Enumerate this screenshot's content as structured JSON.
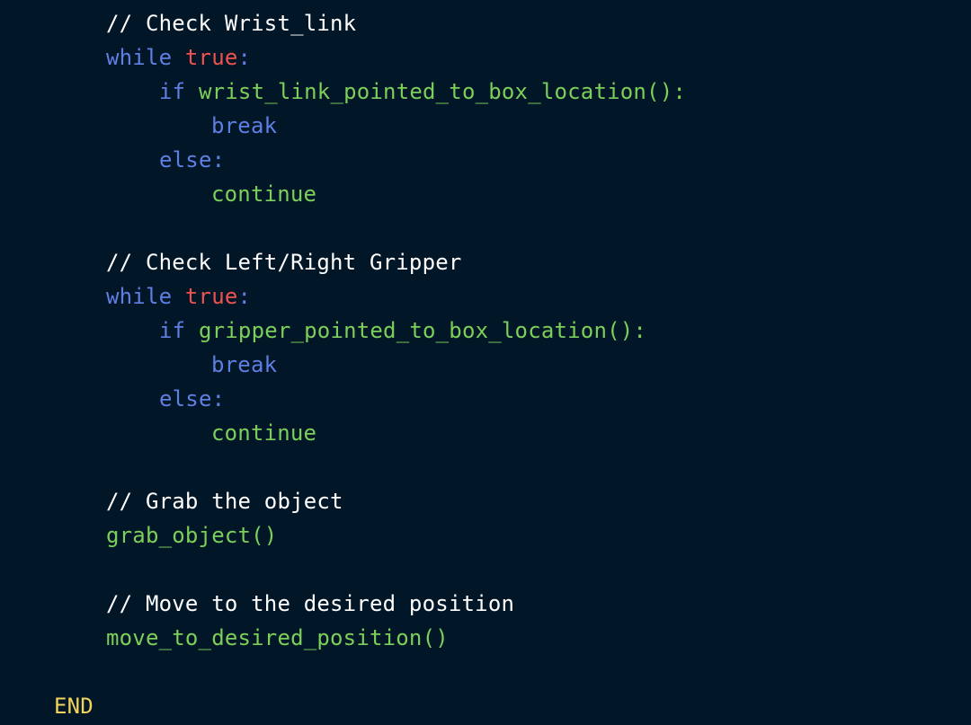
{
  "code": {
    "block1": {
      "comment": "// Check Wrist_link",
      "while_kw": "while",
      "true_kw": "true",
      "colon": ":",
      "if_kw": "if",
      "condition": "wrist_link_pointed_to_box_location():",
      "break_kw": "break",
      "else_kw": "else:",
      "continue_kw": "continue"
    },
    "block2": {
      "comment": "// Check Left/Right Gripper",
      "while_kw": "while",
      "true_kw": "true",
      "colon": ":",
      "if_kw": "if",
      "condition": "gripper_pointed_to_box_location():",
      "break_kw": "break",
      "else_kw": "else:",
      "continue_kw": "continue"
    },
    "block3": {
      "comment": "// Grab the object",
      "call": "grab_object()"
    },
    "block4": {
      "comment": "// Move to the desired position",
      "call": "move_to_desired_position()"
    },
    "end_kw": "END"
  },
  "colors": {
    "background": "#011627",
    "comment": "#ffffff",
    "keyword": "#5f7fe3",
    "boolean": "#ef5350",
    "function": "#7ccf5a",
    "end": "#f2d35c"
  }
}
